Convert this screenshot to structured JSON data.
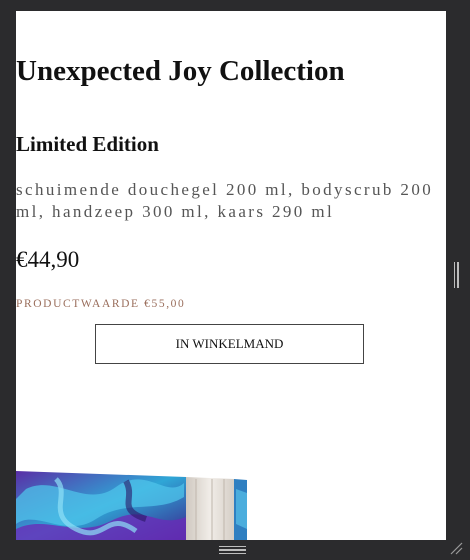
{
  "product": {
    "title": "Unexpected Joy Collection",
    "subtitle": "Limited Edition",
    "description": "schuimende douchegel 200 ml, bodyscrub 200 ml, handzeep 300 ml, kaars 290 ml",
    "price": "€44,90",
    "product_value": "PRODUCTWAARDE €55,00",
    "add_to_cart_label": "IN WINKELMAND",
    "image_icon": "product-photo"
  },
  "colors": {
    "background": "#2b2b2d",
    "page": "#ffffff",
    "product_value_text": "#9a6e5c"
  }
}
